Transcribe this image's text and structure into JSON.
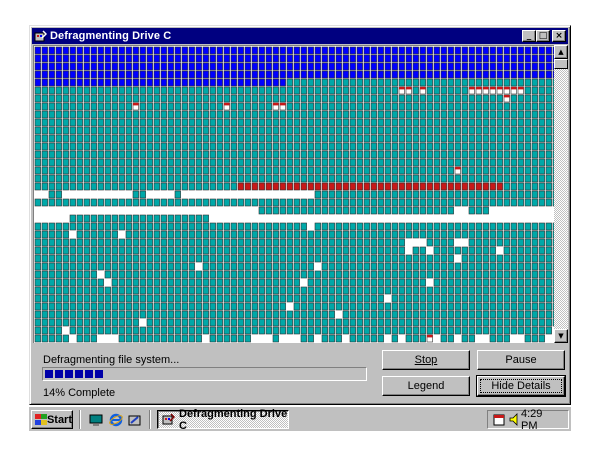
{
  "window": {
    "title": "Defragmenting Drive C"
  },
  "title_buttons": {
    "minimize": "_",
    "maximize": "□",
    "close": "×"
  },
  "status": {
    "text": "Defragmenting file system...",
    "progress_fraction": 0.14,
    "percent_label": "14% Complete"
  },
  "buttons": {
    "stop": "Stop",
    "pause": "Pause",
    "legend": "Legend",
    "hide_details": "Hide Details"
  },
  "taskbar": {
    "start_label": "Start",
    "task_label": "Defragmenting Drive C",
    "clock": "4:29 PM"
  },
  "icons": {
    "quick_launch": [
      "desktop-icon",
      "internet-explorer-icon",
      "channels-icon"
    ],
    "tray": [
      "speaker-icon",
      "scheduler-icon"
    ]
  },
  "colors": {
    "title_bar": "#000080",
    "cluster_optimized": "#0000ff",
    "cluster_unoptimized": "#00a8a8",
    "cluster_writing": "#c81818",
    "progress": "#0000a8"
  }
}
